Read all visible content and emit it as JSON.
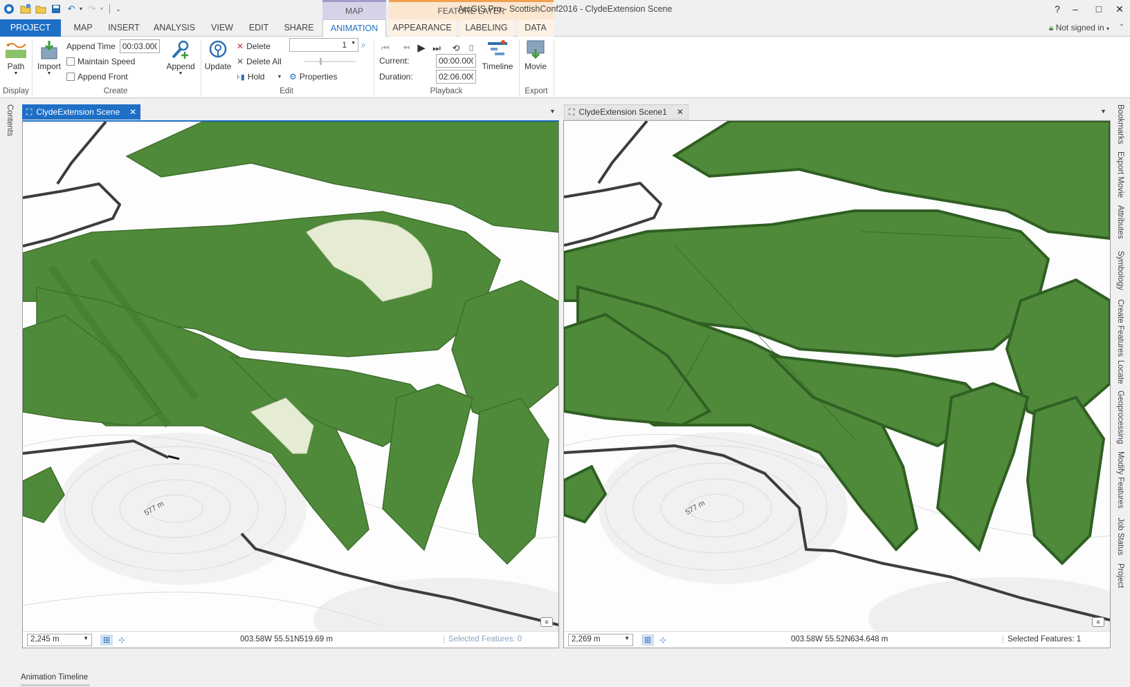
{
  "titlebar": {
    "title": "ArcGIS Pro - ScottishConf2016 - ClydeExtension Scene",
    "context_map": "MAP",
    "context_feature": "FEATURE LAYER",
    "help": "?",
    "minimize": "–",
    "maximize": "□",
    "close": "✕"
  },
  "tabs": {
    "project": "PROJECT",
    "map": "MAP",
    "insert": "INSERT",
    "analysis": "ANALYSIS",
    "view": "VIEW",
    "edit": "EDIT",
    "share": "SHARE",
    "animation": "ANIMATION",
    "appearance": "APPEARANCE",
    "labeling": "LABELING",
    "data": "DATA",
    "signin": "Not signed in"
  },
  "ribbon": {
    "display": {
      "path": "Path",
      "label": "Display"
    },
    "create": {
      "import": "Import",
      "append_time_label": "Append Time",
      "append_time_value": "00:03.000",
      "maintain_speed": "Maintain Speed",
      "append_front": "Append Front",
      "append": "Append",
      "label": "Create"
    },
    "edit": {
      "update": "Update",
      "delete": "Delete",
      "delete_all": "Delete All",
      "hold": "Hold",
      "frame_value": "1",
      "properties": "Properties",
      "label": "Edit"
    },
    "playback": {
      "current_label": "Current:",
      "current_value": "00:00.000",
      "duration_label": "Duration:",
      "duration_value": "02:06.000",
      "timeline": "Timeline",
      "label": "Playback"
    },
    "export": {
      "movie": "Movie",
      "label": "Export"
    }
  },
  "left_strip": {
    "contents": "Contents"
  },
  "right_strip": {
    "bookmarks": "Bookmarks",
    "export_movie": "Export Movie",
    "attributes": "Attributes",
    "symbology": "Symbology",
    "create_features": "Create Features",
    "locate": "Locate",
    "geoprocessing": "Geoprocessing",
    "modify_features": "Modify Features",
    "job_status": "Job Status",
    "project": "Project"
  },
  "pane_left": {
    "tab_title": "ClydeExtension Scene",
    "scale": "2,245 m",
    "coords": "003.58W 55.51N",
    "elevation": "519.69 m",
    "selected": "Selected Features: 0",
    "label_contour": "577 m"
  },
  "pane_right": {
    "tab_title": "ClydeExtension Scene1",
    "scale": "2,269 m",
    "coords": "003.58W 55.52N",
    "elevation": "634.648 m",
    "selected": "Selected Features: 1",
    "label_contour": "577 m"
  },
  "bottom": {
    "anim_timeline": "Animation Timeline"
  },
  "colors": {
    "accent": "#1e6fc6",
    "forest": "#4f8a3a",
    "forest_dark": "#2f5f22",
    "clearing": "#e6ecd4",
    "boundary": "#3d3d3d"
  }
}
